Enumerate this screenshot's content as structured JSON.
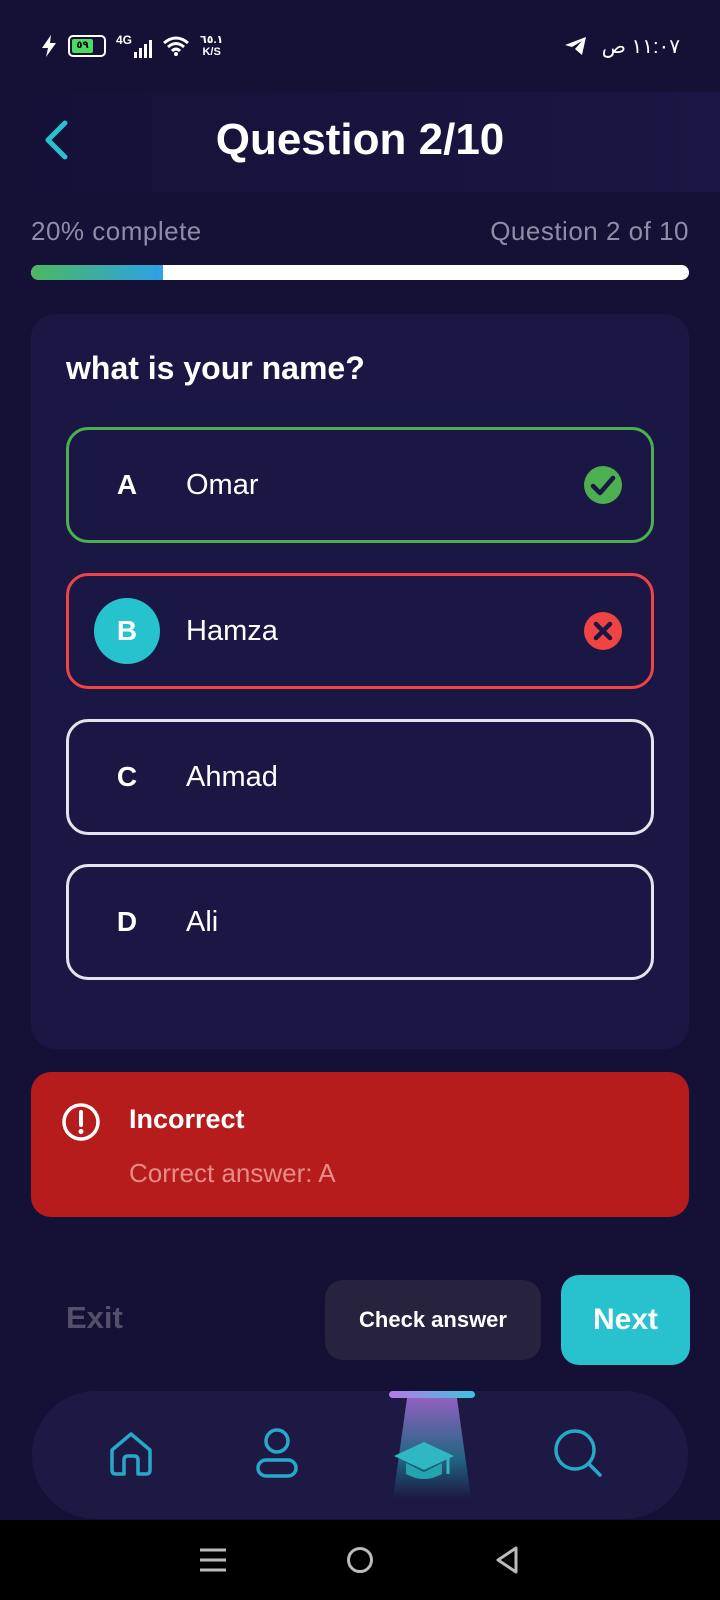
{
  "status_bar": {
    "time": "١١:٠٧ ص",
    "network": "4G",
    "speed_value": "٦٥.١",
    "speed_unit": "K/S",
    "battery_level": "٥٩"
  },
  "header": {
    "title": "Question 2/10"
  },
  "progress": {
    "complete_label": "20% complete",
    "count_label": "Question 2 of 10",
    "fraction": 0.2
  },
  "question": {
    "text": "what is your name?",
    "options": [
      {
        "letter": "A",
        "text": "Omar",
        "state": "correct"
      },
      {
        "letter": "B",
        "text": "Hamza",
        "state": "wrong-selected"
      },
      {
        "letter": "C",
        "text": "Ahmad",
        "state": "neutral"
      },
      {
        "letter": "D",
        "text": "Ali",
        "state": "neutral"
      }
    ]
  },
  "feedback": {
    "title": "Incorrect",
    "message": "Correct answer: A"
  },
  "actions": {
    "exit_label": "Exit",
    "check_label": "Check answer",
    "next_label": "Next"
  },
  "bottom_nav": {
    "items": [
      "home-icon",
      "profile-icon",
      "graduation-cap-icon",
      "search-icon"
    ],
    "active": "graduation-cap-icon"
  },
  "colors": {
    "background": "#141036",
    "card": "#1b1745",
    "accent": "#26c3cf",
    "correct": "#4caf50",
    "wrong": "#ef4444",
    "feedback_bg": "#b71c1c"
  }
}
